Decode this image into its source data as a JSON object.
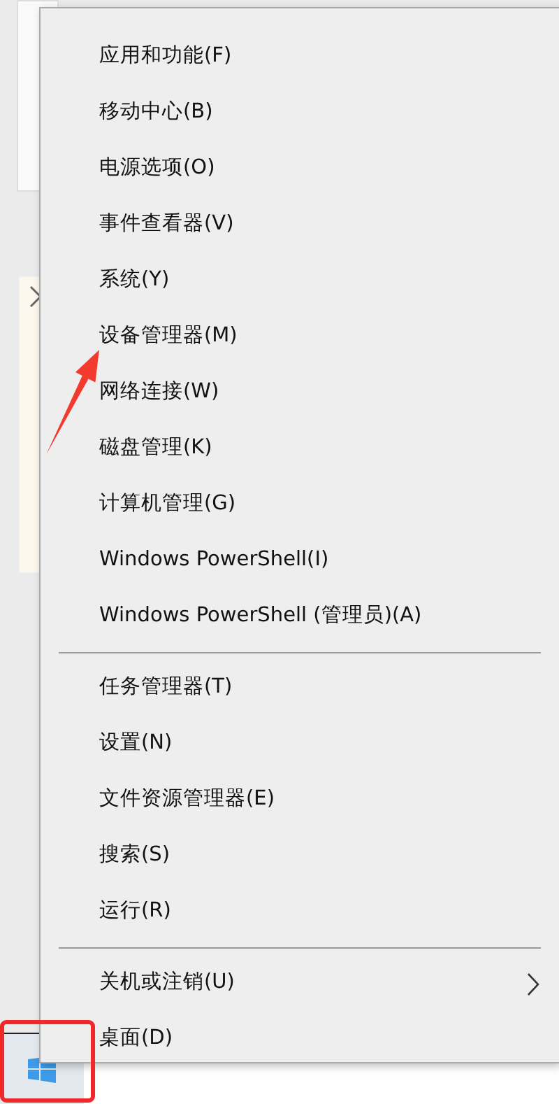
{
  "context_menu": {
    "groups": [
      {
        "items": [
          {
            "label": "应用和功能(F)",
            "has_submenu": false
          },
          {
            "label": "移动中心(B)",
            "has_submenu": false
          },
          {
            "label": "电源选项(O)",
            "has_submenu": false
          },
          {
            "label": "事件查看器(V)",
            "has_submenu": false
          },
          {
            "label": "系统(Y)",
            "has_submenu": false
          },
          {
            "label": "设备管理器(M)",
            "has_submenu": false
          },
          {
            "label": "网络连接(W)",
            "has_submenu": false
          },
          {
            "label": "磁盘管理(K)",
            "has_submenu": false
          },
          {
            "label": "计算机管理(G)",
            "has_submenu": false
          },
          {
            "label": "Windows PowerShell(I)",
            "has_submenu": false
          },
          {
            "label": "Windows PowerShell (管理员)(A)",
            "has_submenu": false
          }
        ]
      },
      {
        "items": [
          {
            "label": "任务管理器(T)",
            "has_submenu": false
          },
          {
            "label": "设置(N)",
            "has_submenu": false
          },
          {
            "label": "文件资源管理器(E)",
            "has_submenu": false
          },
          {
            "label": "搜索(S)",
            "has_submenu": false
          },
          {
            "label": "运行(R)",
            "has_submenu": false
          }
        ]
      },
      {
        "items": [
          {
            "label": "关机或注销(U)",
            "has_submenu": true
          },
          {
            "label": "桌面(D)",
            "has_submenu": false
          }
        ]
      }
    ]
  }
}
